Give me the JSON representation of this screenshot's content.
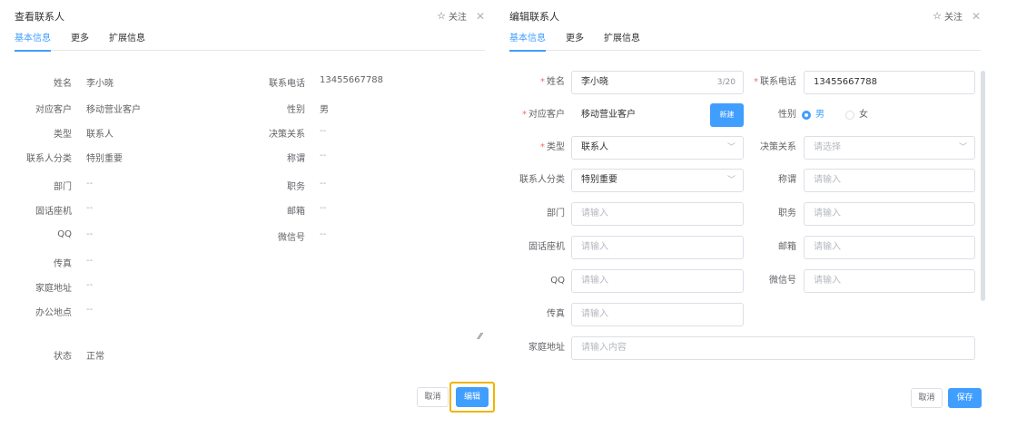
{
  "view": {
    "title": "查看联系人",
    "follow_label": "关注",
    "tabs": [
      "基本信息",
      "更多",
      "扩展信息"
    ],
    "left_fields": [
      {
        "label": "姓名",
        "value": "李小晓"
      },
      {
        "label": "对应客户",
        "value": "移动营业客户"
      },
      {
        "label": "类型",
        "value": "联系人"
      },
      {
        "label": "联系人分类",
        "value": "特别重要"
      },
      {
        "label": "部门",
        "value": "--"
      },
      {
        "label": "固话座机",
        "value": "--"
      },
      {
        "label": "QQ",
        "value": "--"
      },
      {
        "label": "传真",
        "value": "--"
      },
      {
        "label": "家庭地址",
        "value": "--"
      },
      {
        "label": "办公地点",
        "value": "--"
      }
    ],
    "right_fields": [
      {
        "label": "联系电话",
        "value": "13455667788"
      },
      {
        "label": "性别",
        "value": "男"
      },
      {
        "label": "决策关系",
        "value": "--"
      },
      {
        "label": "称谓",
        "value": "--"
      },
      {
        "label": "职务",
        "value": "--"
      },
      {
        "label": "邮箱",
        "value": "--"
      },
      {
        "label": "微信号",
        "value": "--"
      }
    ],
    "status": {
      "label": "状态",
      "value": "正常"
    },
    "cancel_label": "取消",
    "edit_label": "编辑"
  },
  "edit": {
    "title": "编辑联系人",
    "follow_label": "关注",
    "tabs": [
      "基本信息",
      "更多",
      "扩展信息"
    ],
    "name": {
      "label": "姓名",
      "value": "李小晓",
      "count": "3/20"
    },
    "phone": {
      "label": "联系电话",
      "value": "13455667788"
    },
    "customer": {
      "label": "对应客户",
      "value": "移动营业客户",
      "new_label": "新建"
    },
    "gender": {
      "label": "性别",
      "options": [
        "男",
        "女"
      ],
      "selected": "男"
    },
    "type": {
      "label": "类型",
      "value": "联系人"
    },
    "decision": {
      "label": "决策关系",
      "placeholder": "请选择"
    },
    "category": {
      "label": "联系人分类",
      "value": "特别重要"
    },
    "title_field": {
      "label": "称谓",
      "placeholder": "请输入"
    },
    "dept": {
      "label": "部门",
      "placeholder": "请输入"
    },
    "position": {
      "label": "职务",
      "placeholder": "请输入"
    },
    "landline": {
      "label": "固话座机",
      "placeholder": "请输入"
    },
    "email": {
      "label": "邮箱",
      "placeholder": "请输入"
    },
    "qq": {
      "label": "QQ",
      "placeholder": "请输入"
    },
    "wechat": {
      "label": "微信号",
      "placeholder": "请输入"
    },
    "fax": {
      "label": "传真",
      "placeholder": "请输入"
    },
    "address": {
      "label": "家庭地址",
      "placeholder": "请输入内容"
    },
    "cancel_label": "取消",
    "save_label": "保存"
  },
  "colors": {
    "primary": "#409eff",
    "required": "#f56c6c",
    "highlight": "#f0b400"
  },
  "icons": {
    "follow": "star-outline-icon",
    "close": "close-icon",
    "select": "chevron-down-icon",
    "resize": "resize-handle-icon"
  }
}
